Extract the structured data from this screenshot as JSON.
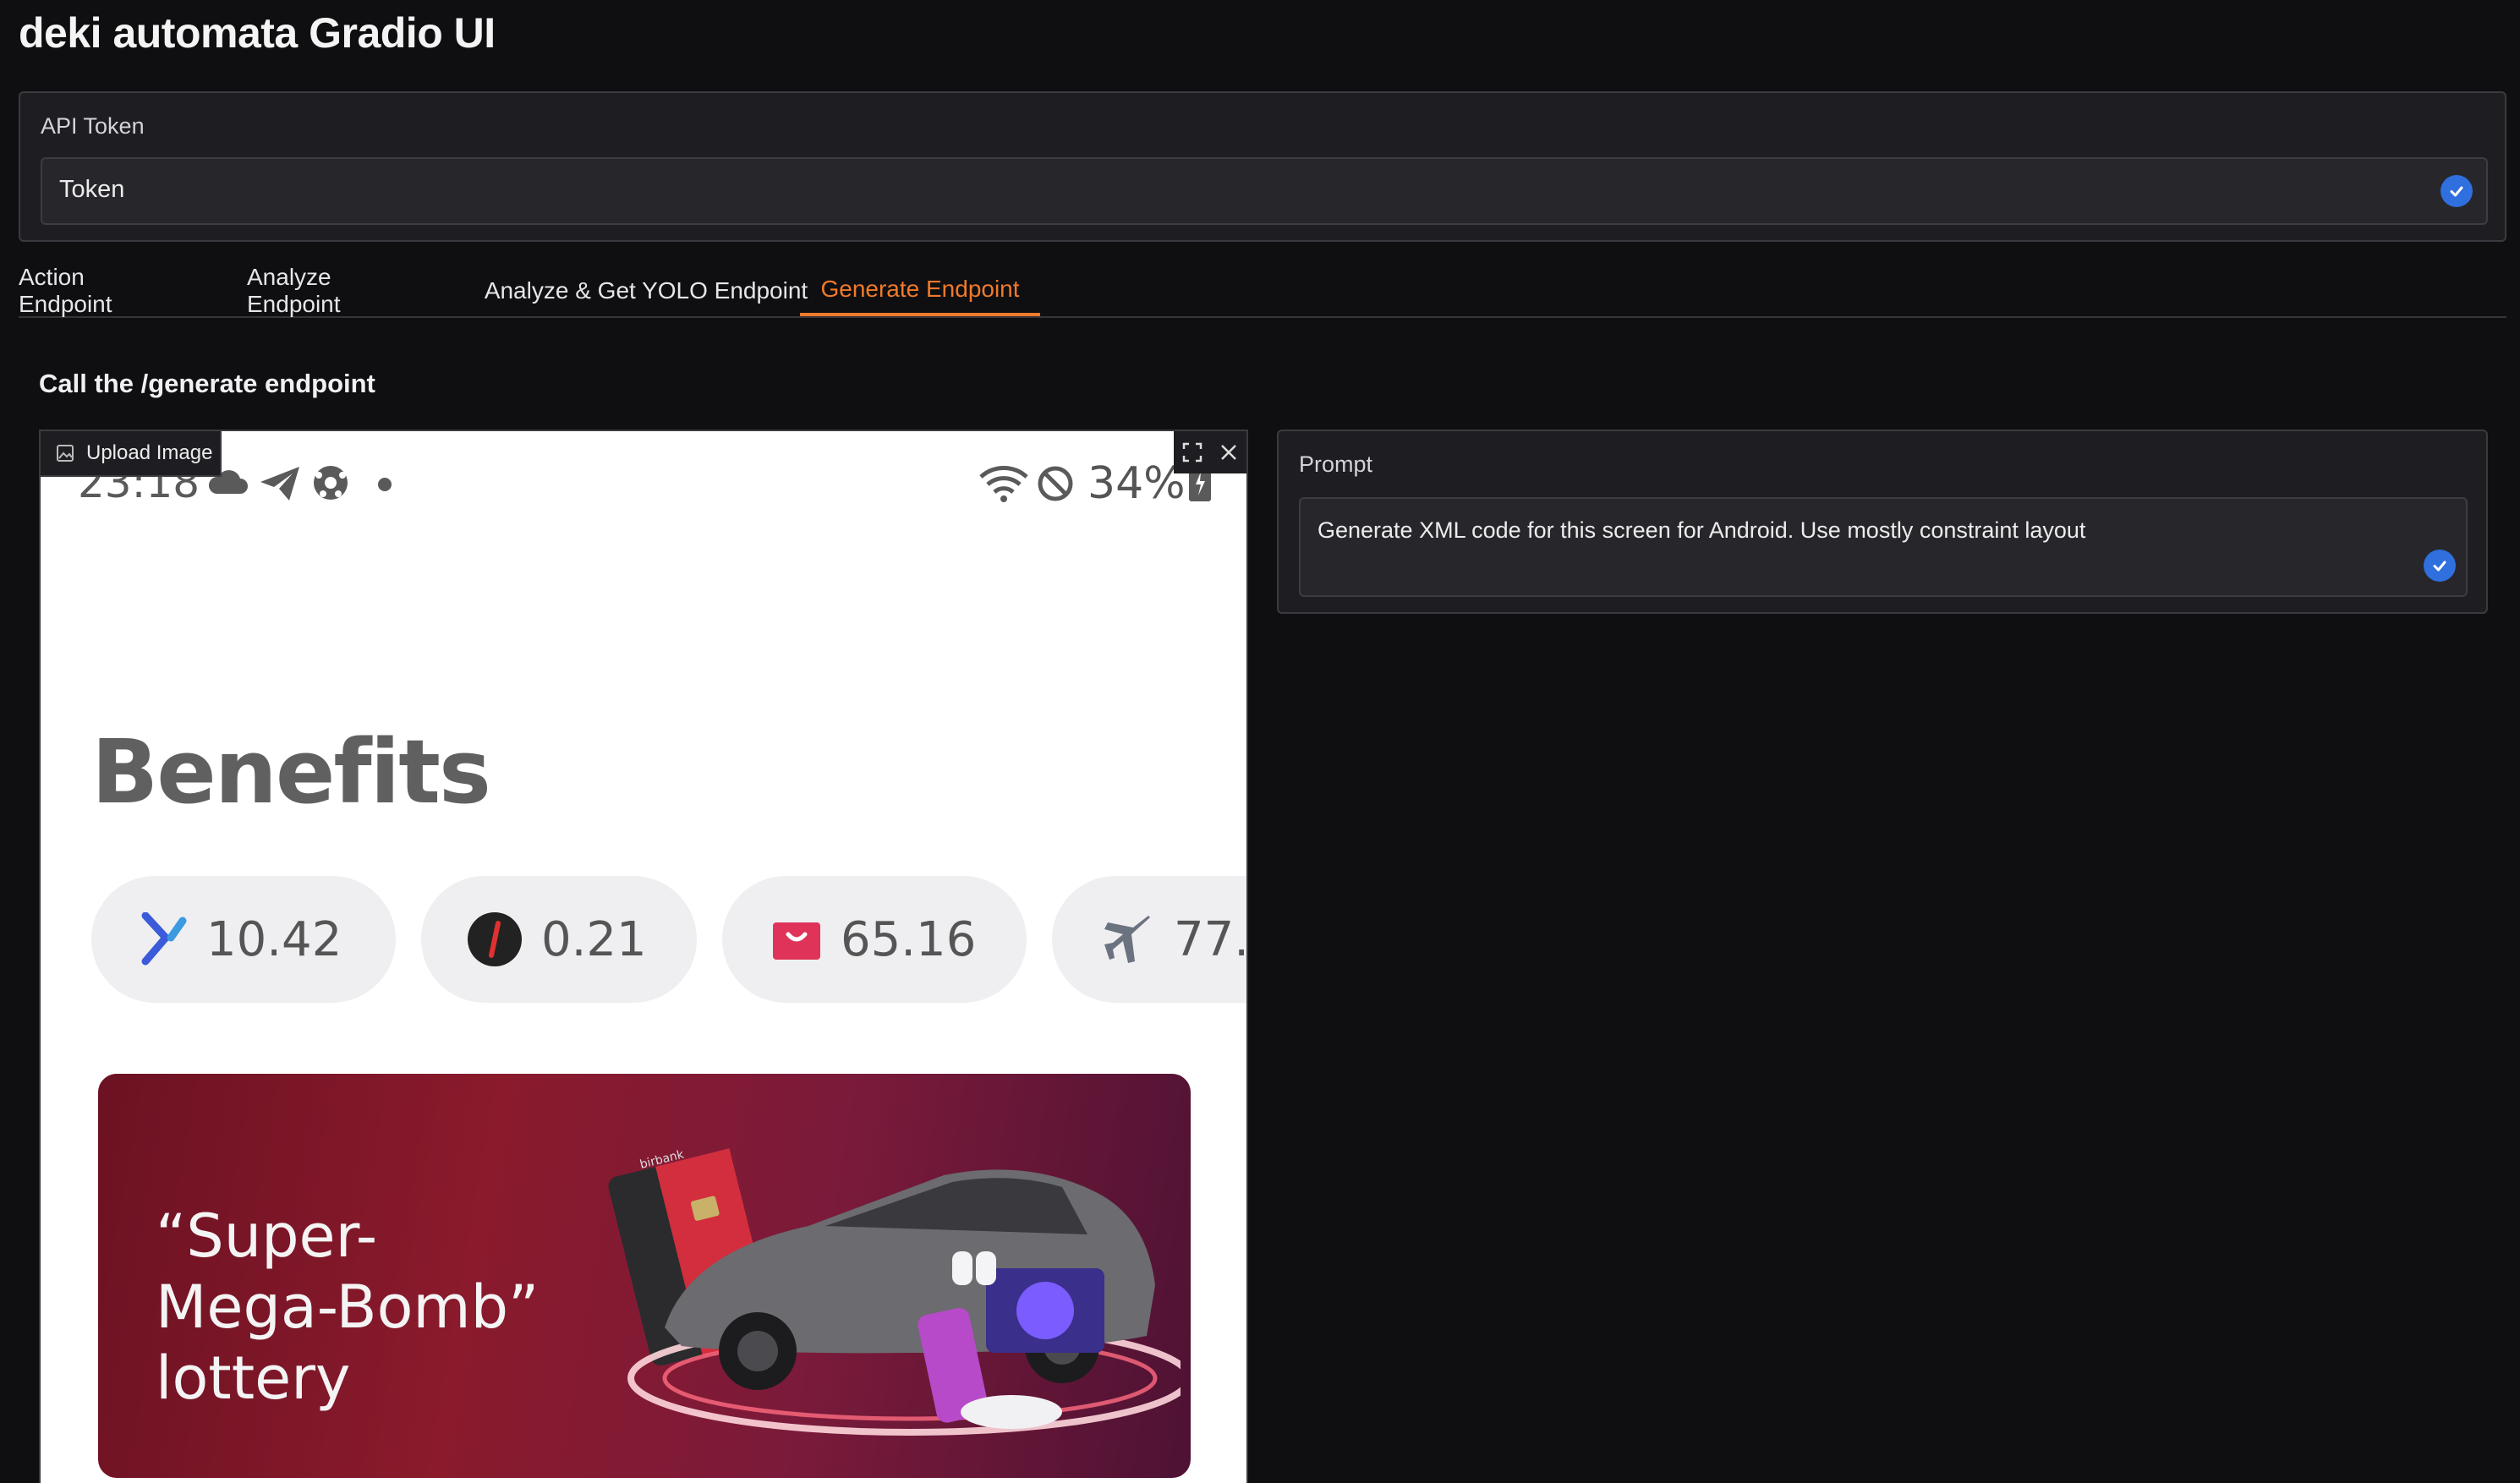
{
  "app": {
    "title": "deki automata Gradio UI"
  },
  "api_token": {
    "label": "API Token",
    "value": "Token"
  },
  "tabs": [
    {
      "label": "Action Endpoint",
      "active": false
    },
    {
      "label": "Analyze Endpoint",
      "active": false
    },
    {
      "label": "Analyze & Get YOLO Endpoint",
      "active": false
    },
    {
      "label": "Generate Endpoint",
      "active": true
    }
  ],
  "generate": {
    "heading": "Call the /generate endpoint",
    "image_panel": {
      "label": "Upload Image",
      "phone": {
        "status_time": "23:18",
        "battery": "34%",
        "title": "Benefits",
        "pills": [
          {
            "icon": "blue-chevron-icon",
            "value": "10.42"
          },
          {
            "icon": "black-circle-icon",
            "value": "0.21"
          },
          {
            "icon": "red-bag-icon",
            "value": "65.16"
          },
          {
            "icon": "airplane-icon",
            "value": "77."
          }
        ],
        "banner": {
          "line1": "“Super-",
          "line2": "Mega-Bomb”",
          "line3": "lottery",
          "card_text": "birbank"
        }
      }
    },
    "prompt": {
      "label": "Prompt",
      "value": "Generate XML code for this screen for Android. Use mostly constraint layout"
    }
  },
  "colors": {
    "accent": "#f07a2a",
    "check": "#2f6fde",
    "background": "#0f0f11"
  }
}
